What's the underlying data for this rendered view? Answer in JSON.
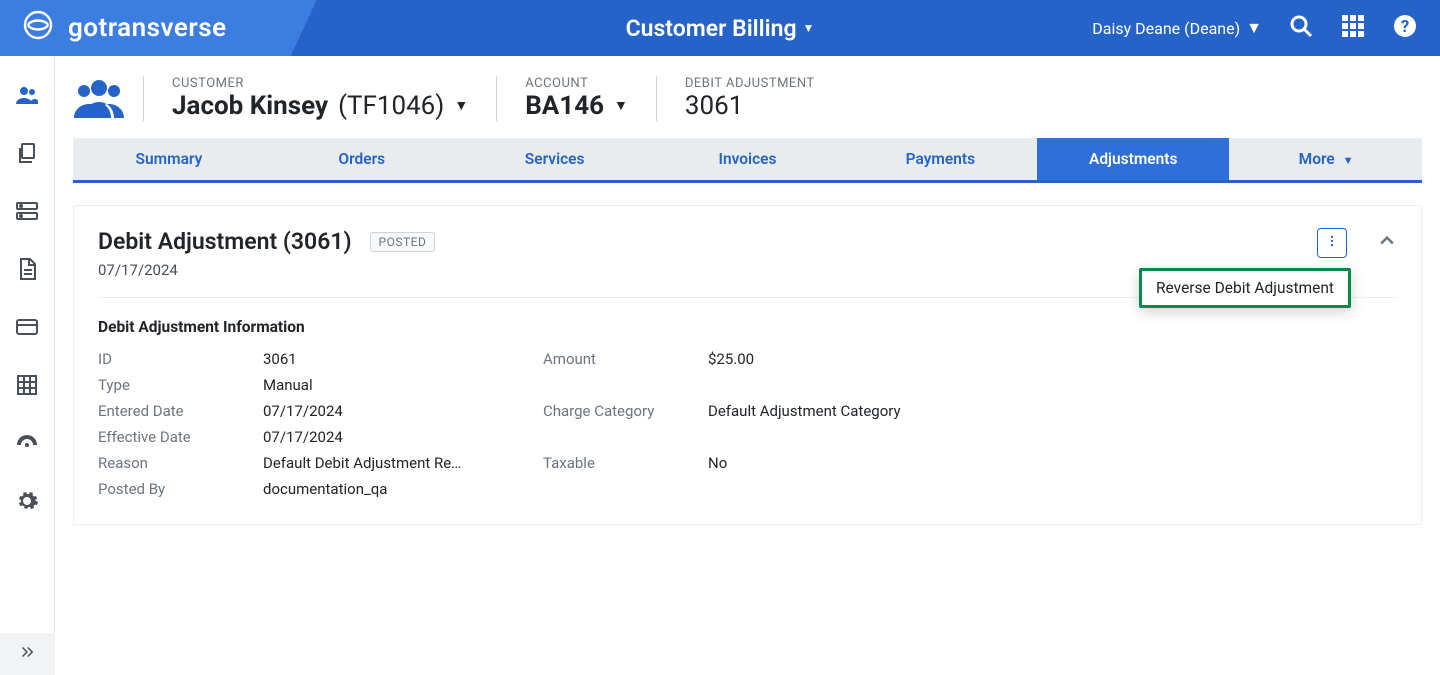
{
  "brand": "gotransverse",
  "top_title": "Customer Billing",
  "user_name": "Daisy Deane (Deane)",
  "context": {
    "customer": {
      "label": "CUSTOMER",
      "name": "Jacob Kinsey",
      "code": "(TF1046)"
    },
    "account": {
      "label": "ACCOUNT",
      "value": "BA146"
    },
    "adjustment": {
      "label": "DEBIT ADJUSTMENT",
      "value": "3061"
    }
  },
  "tabs": {
    "summary": "Summary",
    "orders": "Orders",
    "services": "Services",
    "invoices": "Invoices",
    "payments": "Payments",
    "adjustments": "Adjustments",
    "more": "More"
  },
  "card": {
    "title": "Debit Adjustment (3061)",
    "status": "POSTED",
    "date": "07/17/2024",
    "section_title": "Debit Adjustment Information",
    "left": {
      "id": {
        "k": "ID",
        "v": "3061"
      },
      "type": {
        "k": "Type",
        "v": "Manual"
      },
      "entered": {
        "k": "Entered Date",
        "v": "07/17/2024"
      },
      "effective": {
        "k": "Effective Date",
        "v": "07/17/2024"
      },
      "reason": {
        "k": "Reason",
        "v": "Default Debit Adjustment Re…"
      },
      "postedby": {
        "k": "Posted By",
        "v": "documentation_qa"
      }
    },
    "right": {
      "amount": {
        "k": "Amount",
        "v": "$25.00"
      },
      "category": {
        "k": "Charge Category",
        "v": "Default Adjustment Category"
      },
      "taxable": {
        "k": "Taxable",
        "v": "No"
      }
    },
    "menu": {
      "reverse": "Reverse Debit Adjustment"
    }
  }
}
